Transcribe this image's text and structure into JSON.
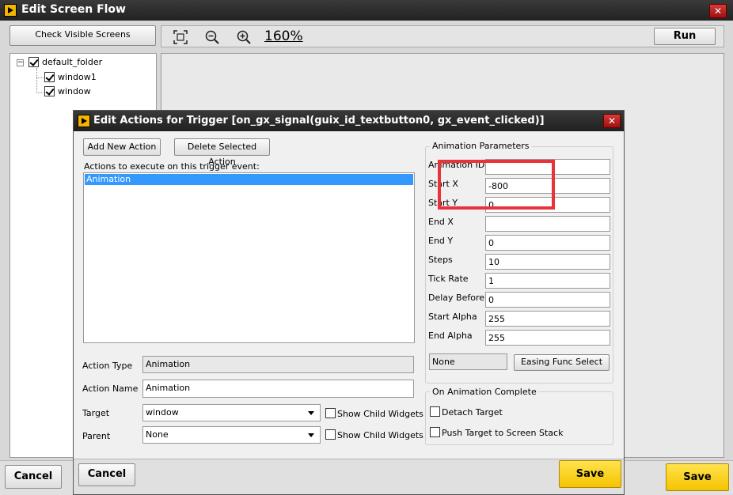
{
  "window": {
    "title": "Edit Screen Flow",
    "close_label": "✕"
  },
  "toolbar": {
    "check_visible_label": "Check Visible Screens",
    "zoom_level": "160%",
    "run_label": "Run"
  },
  "tree": {
    "root": "default_folder",
    "children": [
      "window1",
      "window"
    ]
  },
  "footer": {
    "cancel_label": "Cancel",
    "save_label": "Save"
  },
  "dialog": {
    "title": "Edit Actions for Trigger [on_gx_signal(guix_id_textbutton0, gx_event_clicked)]",
    "close_label": "✕",
    "add_action_label": "Add New Action",
    "delete_action_label": "Delete Selected Action",
    "actions_caption": "Actions to execute on this trigger event:",
    "actions": [
      "Animation"
    ],
    "action_type_label": "Action Type",
    "action_type_value": "Animation",
    "action_name_label": "Action Name",
    "action_name_value": "Animation",
    "target_label": "Target",
    "target_value": "window",
    "parent_label": "Parent",
    "parent_value": "None",
    "show_child_label": "Show Child Widgets",
    "anim_group_title": "Animation Parameters",
    "params": {
      "animation_id": {
        "label": "Animation ID",
        "value": ""
      },
      "start_x": {
        "label": "Start X",
        "value": "-800"
      },
      "start_y": {
        "label": "Start Y",
        "value": "0"
      },
      "end_x": {
        "label": "End X",
        "value": ""
      },
      "end_y": {
        "label": "End Y",
        "value": "0"
      },
      "steps": {
        "label": "Steps",
        "value": "10"
      },
      "tick_rate": {
        "label": "Tick Rate",
        "value": "1"
      },
      "delay_before": {
        "label": "Delay Before",
        "value": "0"
      },
      "start_alpha": {
        "label": "Start Alpha",
        "value": "255"
      },
      "end_alpha": {
        "label": "End Alpha",
        "value": "255"
      }
    },
    "easing_value": "None",
    "easing_button_label": "Easing Func Select",
    "complete_group_title": "On Animation Complete",
    "detach_label": "Detach Target",
    "push_label": "Push Target to Screen Stack",
    "cancel_label": "Cancel",
    "save_label": "Save"
  },
  "colors": {
    "accent_save": "#f5c400",
    "highlight_box": "#e8333a",
    "selection": "#3399ff"
  }
}
